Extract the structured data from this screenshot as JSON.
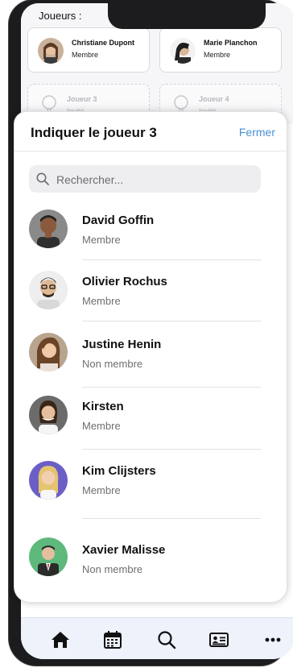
{
  "top": {
    "section_label": "Joueurs :",
    "players": [
      {
        "name": "Christiane Dupont",
        "role": "Membre"
      },
      {
        "name": "Marie Planchon",
        "role": "Membre"
      },
      {
        "name": "Joueur 3",
        "role": "Invité"
      },
      {
        "name": "Joueur 4",
        "role": "Invité"
      }
    ]
  },
  "sheet": {
    "title": "Indiquer le joueur 3",
    "close_label": "Fermer",
    "search_placeholder": "Rechercher...",
    "people": [
      {
        "name": "David Goffin",
        "status": "Membre"
      },
      {
        "name": "Olivier Rochus",
        "status": "Membre"
      },
      {
        "name": "Justine Henin",
        "status": "Non membre"
      },
      {
        "name": "Kirsten",
        "status": "Membre"
      },
      {
        "name": "Kim Clijsters",
        "status": "Membre"
      },
      {
        "name": "Xavier Malisse",
        "status": "Non membre"
      }
    ]
  },
  "tabbar": {
    "icons": [
      "home-icon",
      "calendar-icon",
      "search-icon",
      "id-card-icon",
      "more-icon"
    ]
  },
  "colors": {
    "accent": "#4a90d9",
    "tabbar_bg": "#eef2fa"
  }
}
